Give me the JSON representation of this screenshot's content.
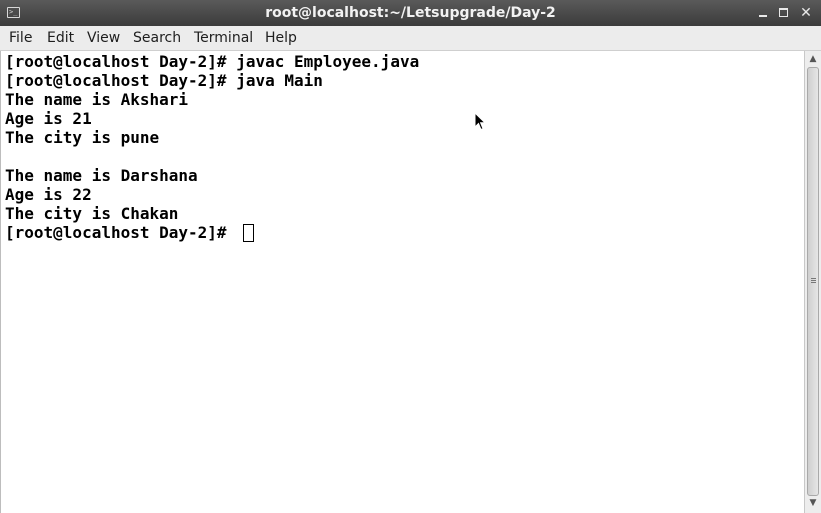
{
  "window": {
    "title": "root@localhost:~/Letsupgrade/Day-2",
    "icon": "terminal-icon",
    "controls": [
      "minimize-icon",
      "maximize-icon",
      "close-icon"
    ],
    "close_glyph": "✕"
  },
  "menu": {
    "items": [
      {
        "label": "File"
      },
      {
        "label": "Edit"
      },
      {
        "label": "View"
      },
      {
        "label": "Search"
      },
      {
        "label": "Terminal"
      },
      {
        "label": "Help"
      }
    ]
  },
  "terminal": {
    "lines": [
      "[root@localhost Day-2]# javac Employee.java",
      "[root@localhost Day-2]# java Main",
      "The name is Akshari",
      "Age is 21",
      "The city is pune",
      "",
      "The name is Darshana",
      "Age is 22",
      "The city is Chakan",
      "[root@localhost Day-2]# "
    ],
    "colors": {
      "background": "#ffffff",
      "text": "#000000"
    }
  },
  "scrollbar": {
    "up_glyph": "▲",
    "down_glyph": "▼"
  }
}
